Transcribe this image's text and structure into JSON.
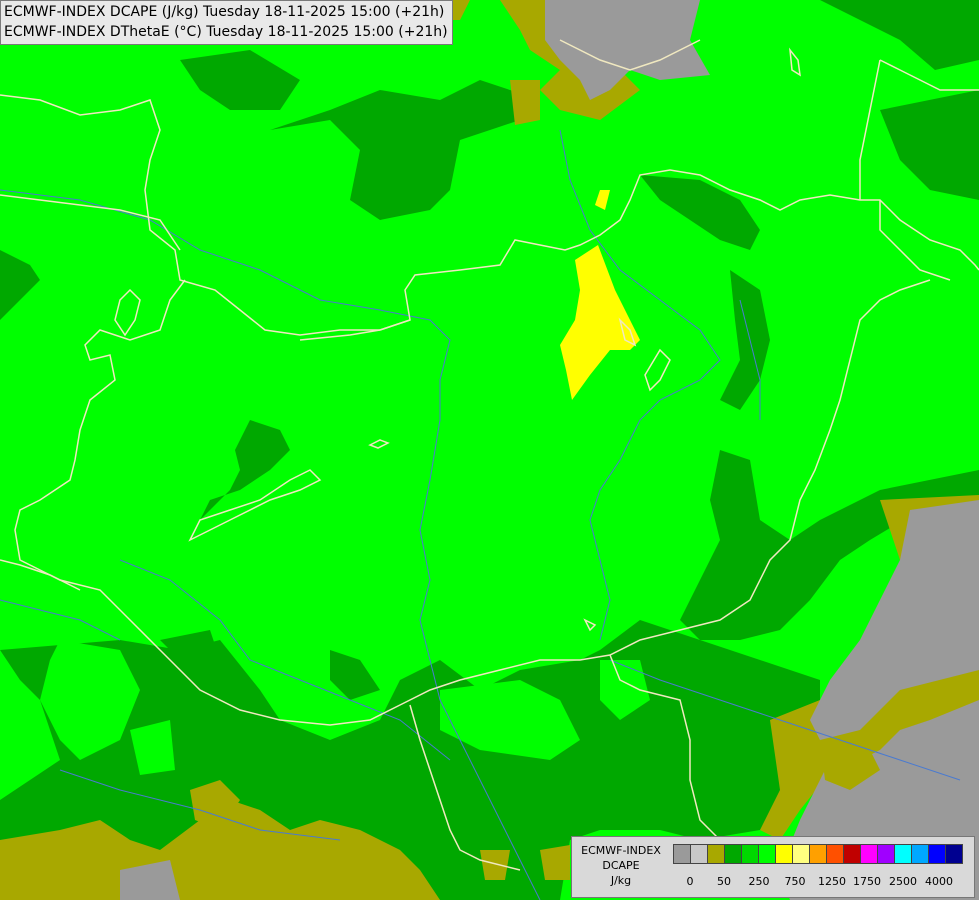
{
  "title": {
    "line1": "ECMWF-INDEX DCAPE (J/kg) Tuesday 18-11-2025 15:00 (+21h)",
    "line2": "ECMWF-INDEX DThetaE (°C) Tuesday 18-11-2025 15:00 (+21h)"
  },
  "colors": {
    "bright_green": "#00ff00",
    "dark_green": "#00a800",
    "olive": "#a8a800",
    "gray": "#9a9a9a",
    "yellow": "#ffff00",
    "border_line": "#f0e8c0",
    "river": "#4a7ad0"
  },
  "legend": {
    "line1": "ECMWF-INDEX",
    "line2": "DCAPE",
    "line3": "J/kg",
    "swatch_colors": [
      "#9a9a9a",
      "#c8c8c8",
      "#a8a800",
      "#00a800",
      "#00d800",
      "#00ff00",
      "#ffff00",
      "#ffff80",
      "#ffa000",
      "#ff5000",
      "#c00000",
      "#ff00ff",
      "#a000ff",
      "#00ffff",
      "#00a8ff",
      "#0000ff",
      "#000090"
    ],
    "ticks": [
      "0",
      "50",
      "250",
      "750",
      "1250",
      "1750",
      "2500",
      "4000"
    ]
  }
}
